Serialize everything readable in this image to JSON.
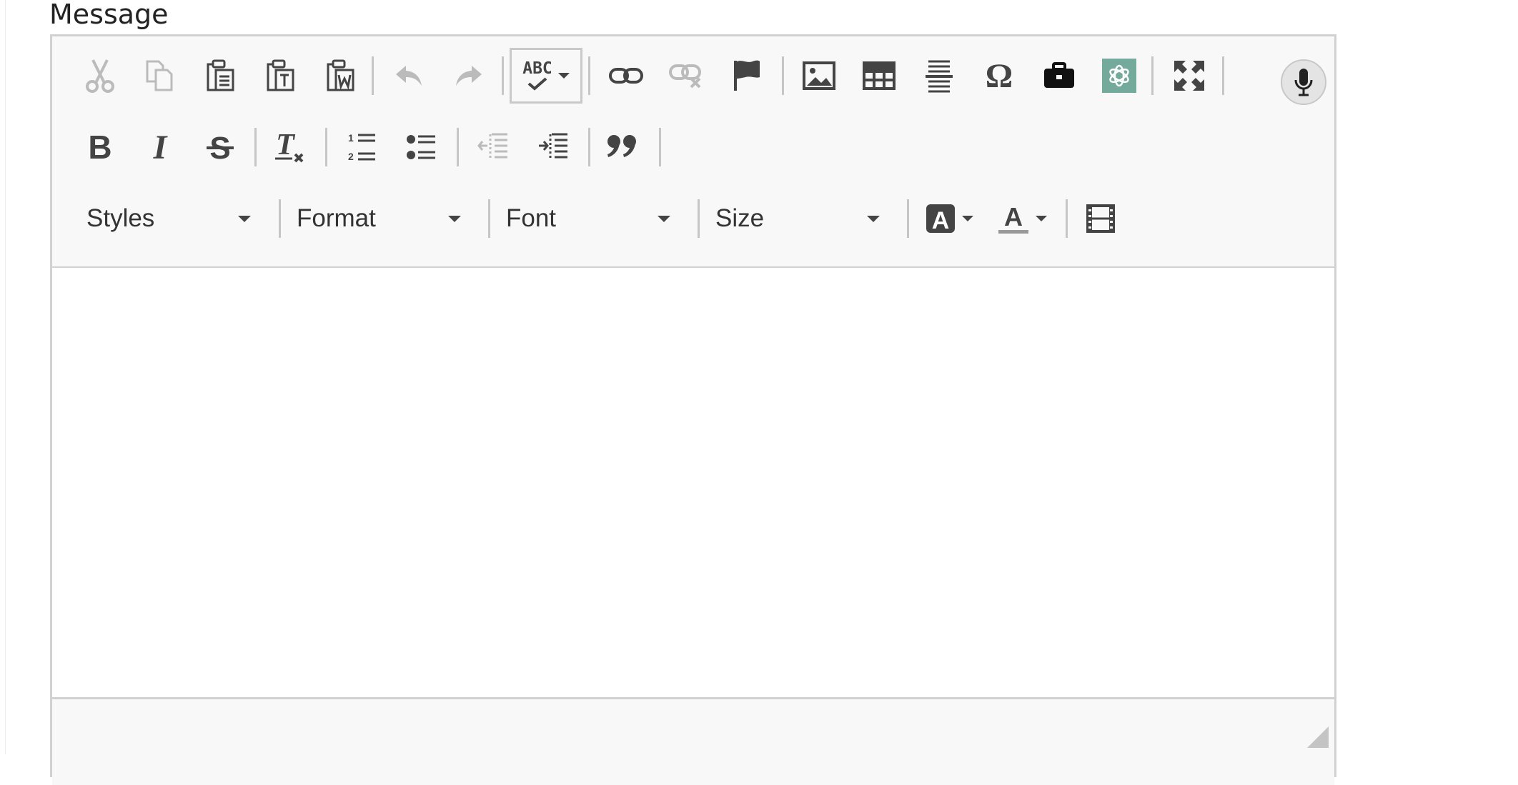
{
  "label": {
    "text": "Message"
  },
  "toolbar": {
    "styles_label": "Styles",
    "format_label": "Format",
    "font_label": "Font",
    "size_label": "Size",
    "spell_label": "ABC",
    "color_letter": "A"
  },
  "colors": {
    "toolbar_bg": "#f8f8f8",
    "border": "#d1d1d1",
    "icon": "#444444",
    "icon_disabled": "#bbbbbb",
    "ai_accent": "#74aa9c"
  },
  "icons": {
    "row1": [
      "cut-icon",
      "copy-icon",
      "paste-icon",
      "paste-text-icon",
      "paste-word-icon",
      "undo-icon",
      "redo-icon",
      "spellcheck-icon",
      "link-icon",
      "unlink-icon",
      "anchor-flag-icon",
      "image-icon",
      "table-icon",
      "horizontal-line-icon",
      "special-char-omega-icon",
      "templates-briefcase-icon",
      "ai-assistant-icon",
      "maximize-icon",
      "microphone-icon"
    ],
    "row2": [
      "bold-icon",
      "italic-icon",
      "strikethrough-icon",
      "remove-format-icon",
      "numbered-list-icon",
      "bulleted-list-icon",
      "outdent-icon",
      "indent-icon",
      "blockquote-icon"
    ],
    "row3": [
      "background-color-icon",
      "text-color-icon",
      "video-film-icon"
    ]
  }
}
